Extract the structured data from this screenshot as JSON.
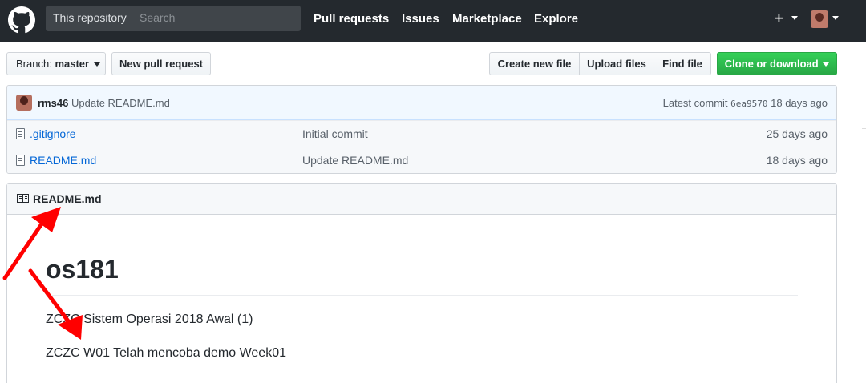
{
  "header": {
    "scope_label": "This repository",
    "search_placeholder": "Search",
    "nav": [
      "Pull requests",
      "Issues",
      "Marketplace",
      "Explore"
    ],
    "plus": "+"
  },
  "toolbar": {
    "branch_prefix": "Branch:",
    "branch_name": "master",
    "new_pr": "New pull request",
    "create_file": "Create new file",
    "upload_files": "Upload files",
    "find_file": "Find file",
    "clone": "Clone or download"
  },
  "commit": {
    "author": "rms46",
    "message": "Update README.md",
    "latest_prefix": "Latest commit",
    "sha": "6ea9570",
    "age": "18 days ago"
  },
  "files": [
    {
      "name": ".gitignore",
      "message": "Initial commit",
      "age": "25 days ago"
    },
    {
      "name": "README.md",
      "message": "Update README.md",
      "age": "18 days ago"
    }
  ],
  "readme": {
    "title": "README.md",
    "heading": "os181",
    "lines": [
      "ZCZC Sistem Operasi 2018 Awal (1)",
      "ZCZC W01 Telah mencoba demo Week01"
    ]
  },
  "colors": {
    "header_bg": "#24292e",
    "link": "#0366d6",
    "clone_green": "#28a745",
    "annotation_red": "#ff0000"
  }
}
